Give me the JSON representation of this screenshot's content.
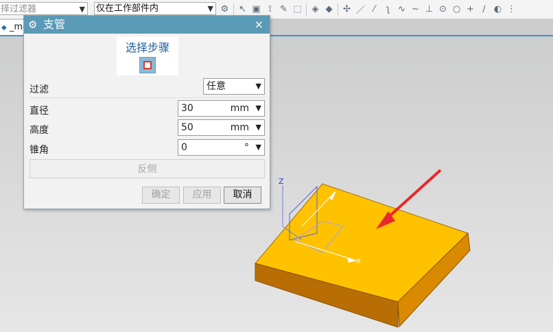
{
  "toolbar": {
    "selection_filter": "择过滤器",
    "scope": "仅在工作部件内",
    "icons": [
      "snap-icon",
      "select-icon",
      "lasso-icon",
      "box-icon",
      "view-icon",
      "point-icon",
      "line-icon",
      "arc-icon",
      "circle-icon"
    ]
  },
  "file_tab": {
    "label": "_mo"
  },
  "dialog": {
    "title": "支管",
    "close_symbol": "×",
    "step_label": "选择步骤",
    "filter_label": "过滤",
    "filter_value": "任意",
    "diameter_label": "直径",
    "diameter_value": "30",
    "diameter_unit": "mm",
    "height_label": "高度",
    "height_value": "50",
    "height_unit": "mm",
    "taper_label": "锥角",
    "taper_value": "0",
    "taper_unit": "°",
    "reverse_label": "反侧",
    "ok_label": "确定",
    "apply_label": "应用",
    "cancel_label": "取消"
  },
  "viewport": {
    "part_color": "#ffc000",
    "part_side_color": "#c27a00",
    "arrow_color": "#e8282a",
    "axis_z": "Z",
    "axis_x": "X"
  }
}
